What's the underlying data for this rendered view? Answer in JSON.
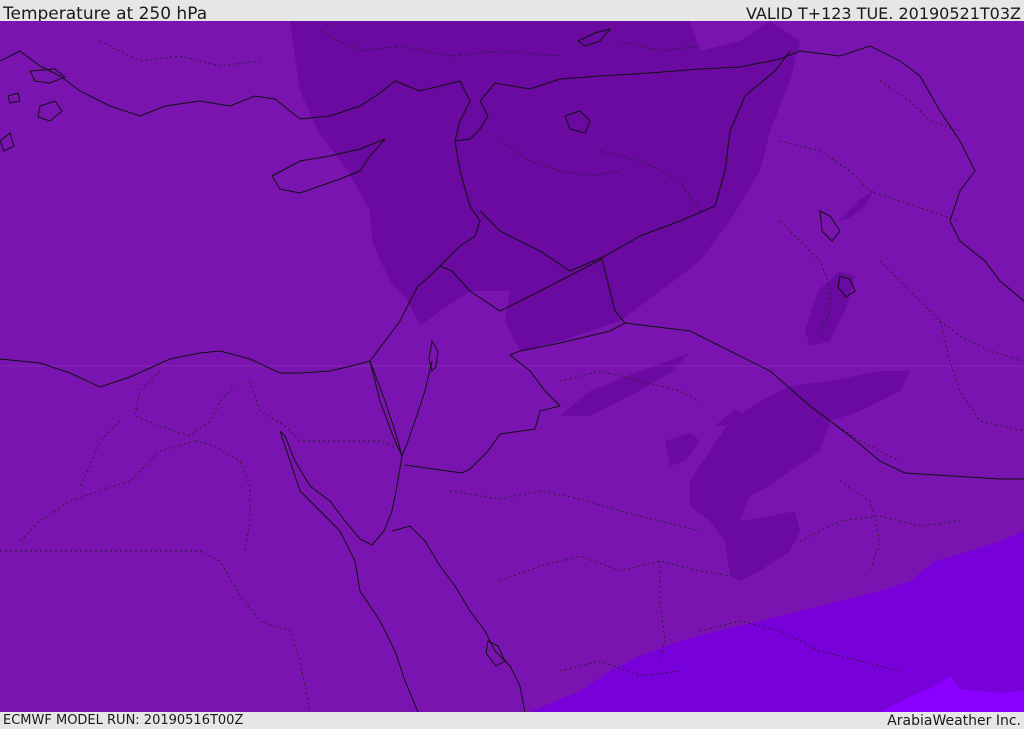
{
  "header": {
    "title": "Temperature at 250 hPa",
    "valid_time": "VALID T+123 TUE. 20190521T03Z"
  },
  "footer": {
    "model_run": "ECMWF MODEL RUN: 20190516T00Z",
    "credit": "ArabiaWeather Inc."
  },
  "map": {
    "colors": {
      "base_fill": "#7a14b0",
      "cold_fill": "#6a0aa0",
      "warm_fill": "#7800d8",
      "warmest_fill": "#8a00ff",
      "border_line": "#111111",
      "admin_line": "#222222"
    }
  }
}
